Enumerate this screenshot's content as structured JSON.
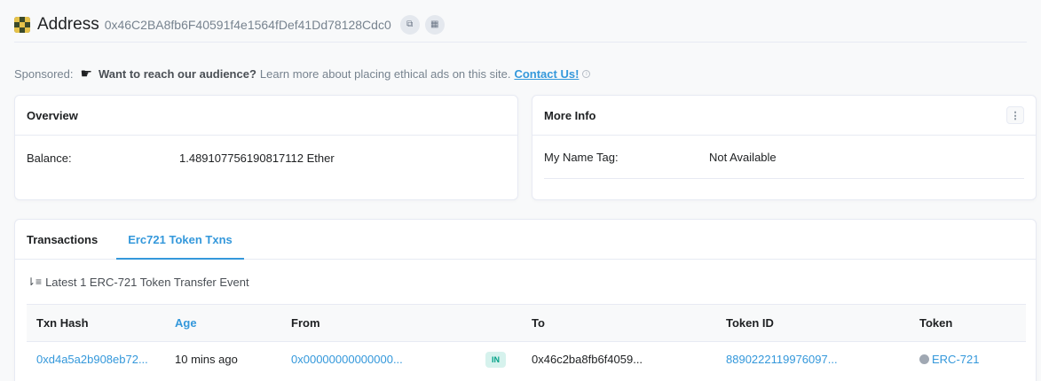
{
  "header": {
    "title": "Address",
    "address": "0x46C2BA8fb6F40591f4e1564fDef41Dd78128Cdc0"
  },
  "sponsored": {
    "label": "Sponsored:",
    "headline": "Want to reach our audience?",
    "text": "Learn more about placing ethical ads on this site.",
    "link": "Contact Us!"
  },
  "overview": {
    "title": "Overview",
    "balance_label": "Balance:",
    "balance_value": "1.489107756190817112 Ether"
  },
  "more_info": {
    "title": "More Info",
    "name_tag_label": "My Name Tag:",
    "name_tag_value": "Not Available"
  },
  "tabs": {
    "transactions": "Transactions",
    "erc721": "Erc721 Token Txns"
  },
  "events_summary": "Latest 1 ERC-721 Token Transfer Event",
  "table": {
    "headers": [
      "Txn Hash",
      "Age",
      "From",
      "",
      "To",
      "Token ID",
      "Token"
    ],
    "rows": [
      {
        "txn_hash": "0xd4a5a2b908eb72...",
        "age": "10 mins ago",
        "from": "0x00000000000000...",
        "direction": "IN",
        "to": "0x46c2ba8fb6f4059...",
        "token_id": "8890222119976097...",
        "token": "ERC-721"
      }
    ]
  },
  "colors": {
    "accent": "#3498db",
    "in_badge_bg": "#d6f2ed",
    "in_badge_text": "#00a186"
  }
}
